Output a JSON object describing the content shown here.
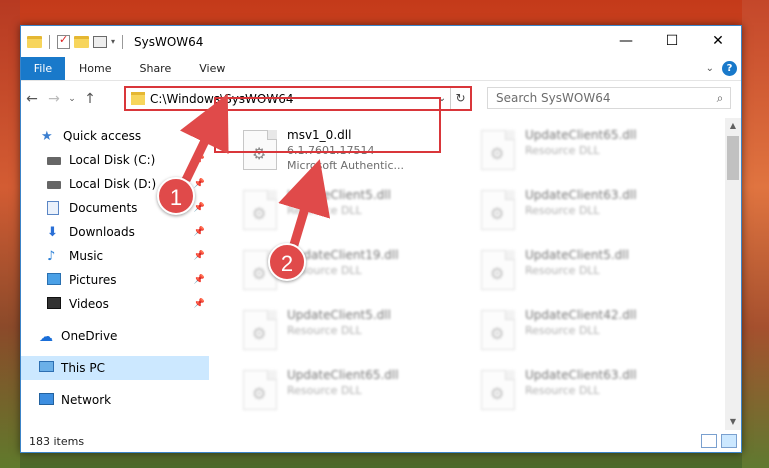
{
  "window": {
    "title": "SysWOW64"
  },
  "ribbon": {
    "tabs": [
      "File",
      "Home",
      "Share",
      "View"
    ]
  },
  "address": {
    "path": "C:\\Windows\\SysWOW64"
  },
  "search": {
    "placeholder": "Search SysWOW64"
  },
  "sidebar": {
    "items": [
      {
        "label": "Quick access",
        "icon": "star-icon"
      },
      {
        "label": "Local Disk (C:)",
        "icon": "disk-icon"
      },
      {
        "label": "Local Disk (D:)",
        "icon": "disk-icon"
      },
      {
        "label": "Documents",
        "icon": "documents-icon"
      },
      {
        "label": "Downloads",
        "icon": "downloads-icon"
      },
      {
        "label": "Music",
        "icon": "music-icon"
      },
      {
        "label": "Pictures",
        "icon": "pictures-icon"
      },
      {
        "label": "Videos",
        "icon": "videos-icon"
      },
      {
        "label": "OneDrive",
        "icon": "onedrive-icon"
      },
      {
        "label": "This PC",
        "icon": "this-pc-icon"
      },
      {
        "label": "Network",
        "icon": "network-icon"
      }
    ]
  },
  "files": [
    {
      "name": "msv1_0.dll",
      "line2": "6.1.7601.17514",
      "line3": "Microsoft Authentic..."
    },
    {
      "name": "UpdateClient65.dll",
      "line2": "Resource DLL"
    },
    {
      "name": "UpdateClient5.dll",
      "line2": "Resource DLL"
    },
    {
      "name": "UpdateClient63.dll",
      "line2": "Resource DLL"
    },
    {
      "name": "UpdateClient19.dll",
      "line2": "Resource DLL"
    },
    {
      "name": "UpdateClient5.dll",
      "line2": "Resource DLL"
    },
    {
      "name": "UpdateClient5.dll",
      "line2": "Resource DLL"
    },
    {
      "name": "UpdateClient42.dll",
      "line2": "Resource DLL"
    },
    {
      "name": "UpdateClient65.dll",
      "line2": "Resource DLL"
    },
    {
      "name": "UpdateClient63.dll",
      "line2": "Resource DLL"
    }
  ],
  "status": {
    "items": "183 items"
  },
  "markers": [
    "1",
    "2"
  ],
  "colors": {
    "accent": "#1979ca",
    "highlight": "#d9363a"
  }
}
